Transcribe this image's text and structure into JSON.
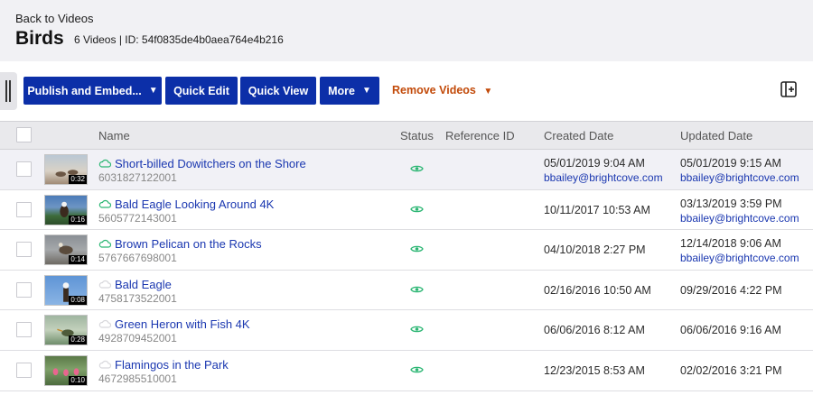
{
  "header": {
    "back_label": "Back to Videos",
    "title": "Birds",
    "subtitle": "6 Videos | ID: 54f0835de4b0aea764e4b216"
  },
  "toolbar": {
    "publish_label": "Publish and Embed...",
    "quick_edit_label": "Quick Edit",
    "quick_view_label": "Quick View",
    "more_label": "More",
    "remove_label": "Remove Videos",
    "caret": "▼"
  },
  "table": {
    "columns": {
      "name": "Name",
      "status": "Status",
      "reference_id": "Reference ID",
      "created_date": "Created Date",
      "updated_date": "Updated Date"
    },
    "rows": [
      {
        "name": "Short-billed Dowitchers on the Shore",
        "id": "6031827122001",
        "duration": "0:32",
        "cloud": "active",
        "created": "05/01/2019 9:04 AM",
        "created_by": "bbailey@brightcove.com",
        "updated": "05/01/2019 9:15 AM",
        "updated_by": "bbailey@brightcove.com"
      },
      {
        "name": "Bald Eagle Looking Around 4K",
        "id": "5605772143001",
        "duration": "0:16",
        "cloud": "active",
        "created": "10/11/2017 10:53 AM",
        "created_by": "",
        "updated": "03/13/2019 3:59 PM",
        "updated_by": "bbailey@brightcove.com"
      },
      {
        "name": "Brown Pelican on the Rocks",
        "id": "5767667698001",
        "duration": "0:14",
        "cloud": "active",
        "created": "04/10/2018 2:27 PM",
        "created_by": "",
        "updated": "12/14/2018 9:06 AM",
        "updated_by": "bbailey@brightcove.com"
      },
      {
        "name": "Bald Eagle",
        "id": "4758173522001",
        "duration": "0:08",
        "cloud": "inactive",
        "created": "02/16/2016 10:50 AM",
        "created_by": "",
        "updated": "09/29/2016 4:22 PM",
        "updated_by": ""
      },
      {
        "name": "Green Heron with Fish 4K",
        "id": "4928709452001",
        "duration": "0:28",
        "cloud": "inactive",
        "created": "06/06/2016 8:12 AM",
        "created_by": "",
        "updated": "06/06/2016 9:16 AM",
        "updated_by": ""
      },
      {
        "name": "Flamingos in the Park",
        "id": "4672985510001",
        "duration": "0:10",
        "cloud": "inactive",
        "created": "12/23/2015 8:53 AM",
        "created_by": "",
        "updated": "02/02/2016 3:21 PM",
        "updated_by": ""
      }
    ]
  },
  "colors": {
    "primary_button": "#0c2fa8",
    "remove_action": "#c24a09",
    "link": "#1a37b0",
    "status_active": "#2bb673",
    "header_bg": "#f1f1f4"
  },
  "icons": {
    "status": "eye-icon",
    "cloud": "cloud-icon",
    "layout": "layout-toggle-icon",
    "handle": "drag-handle-icon"
  }
}
